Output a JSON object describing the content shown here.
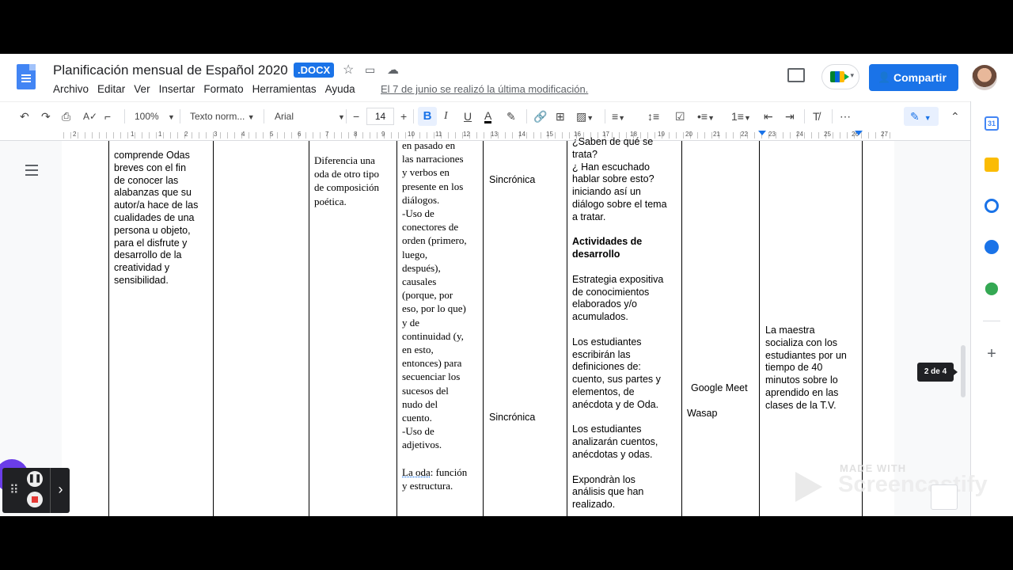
{
  "doc": {
    "title": "Planificación mensual de Español 2020",
    "badge": ".DOCX",
    "last_edit": "El 7 de junio se realizó la última modificación."
  },
  "menu": [
    "Archivo",
    "Editar",
    "Ver",
    "Insertar",
    "Formato",
    "Herramientas",
    "Ayuda"
  ],
  "header": {
    "share_label": "Compartir"
  },
  "toolbar": {
    "zoom": "100%",
    "style": "Texto norm...",
    "font": "Arial",
    "font_size": "14",
    "minus": "−",
    "plus": "+",
    "bold": "B",
    "italic": "I",
    "underline": "U",
    "text_color": "A",
    "more": "⋯"
  },
  "ruler": [
    "2",
    "1",
    "1",
    "2",
    "3",
    "4",
    "5",
    "6",
    "7",
    "8",
    "9",
    "10",
    "11",
    "12",
    "13",
    "14",
    "15",
    "16",
    "17",
    "18",
    "19",
    "20",
    "21",
    "22",
    "23",
    "24",
    "25",
    "26",
    "27"
  ],
  "page_tooltip": "2 de 4",
  "table": {
    "col1": [
      "comprende Odas",
      "breves con el fin",
      "de conocer las",
      "alabanzas que su",
      "autor/a hace de las",
      "cualidades de una",
      "persona u objeto,",
      "para el disfrute y",
      "desarrollo de la",
      "creatividad y",
      "sensibilidad."
    ],
    "col3": [
      "Diferencia una",
      "oda de otro tipo",
      "de composición",
      "poética."
    ],
    "col4": [
      "en pasado en",
      "las narraciones",
      "y verbos en",
      "presente en los",
      "diálogos.",
      "-Uso de",
      "conectores de",
      "orden (primero,",
      "luego,",
      "después),",
      "causales",
      "(porque, por",
      "eso, por lo que)",
      "y de",
      "continuidad (y,",
      "en esto,",
      "entonces) para",
      "secuenciar los",
      "sucesos del",
      "nudo del",
      "cuento.",
      "-Uso de",
      "adjetivos."
    ],
    "col4_end": {
      "word": "La oda",
      "rest": ": función",
      "line2": "y estructura."
    },
    "col5_a": "Sincrónica",
    "col5_b": "Sincrónica",
    "col6_intro": [
      "¿Saben de qué se",
      "trata?",
      "¿ Han escuchado",
      "hablar sobre esto?",
      "iniciando así un",
      "diálogo sobre el tema",
      "a tratar."
    ],
    "col6_heading": [
      "Actividades de",
      "desarrollo"
    ],
    "col6_p1": [
      "Estrategia expositiva",
      "de conocimientos",
      "elaborados y/o",
      "acumulados."
    ],
    "col6_p2": [
      "Los estudiantes",
      "escribirán las",
      "definiciones de:",
      "cuento, sus partes y",
      "elementos, de",
      "anécdota y de Oda."
    ],
    "col6_p3": [
      "Los estudiantes",
      "analizarán cuentos,",
      "anécdotas y odas."
    ],
    "col6_p4": [
      "Expondràn los",
      "análisis que han",
      "realizado."
    ],
    "col7_a": "Google Meet",
    "col7_b": "Wasap",
    "col8": [
      "La maestra",
      "socializa con los",
      "estudiantes por un",
      "tiempo de 40",
      "minutos sobre lo",
      "aprendido en las",
      "clases de la T.V."
    ]
  },
  "overlay": {
    "made_with": "MADE WITH",
    "brand": "Screencastify"
  },
  "colors": {
    "accent": "#1a73e8",
    "docs_blue": "#4285f4"
  }
}
